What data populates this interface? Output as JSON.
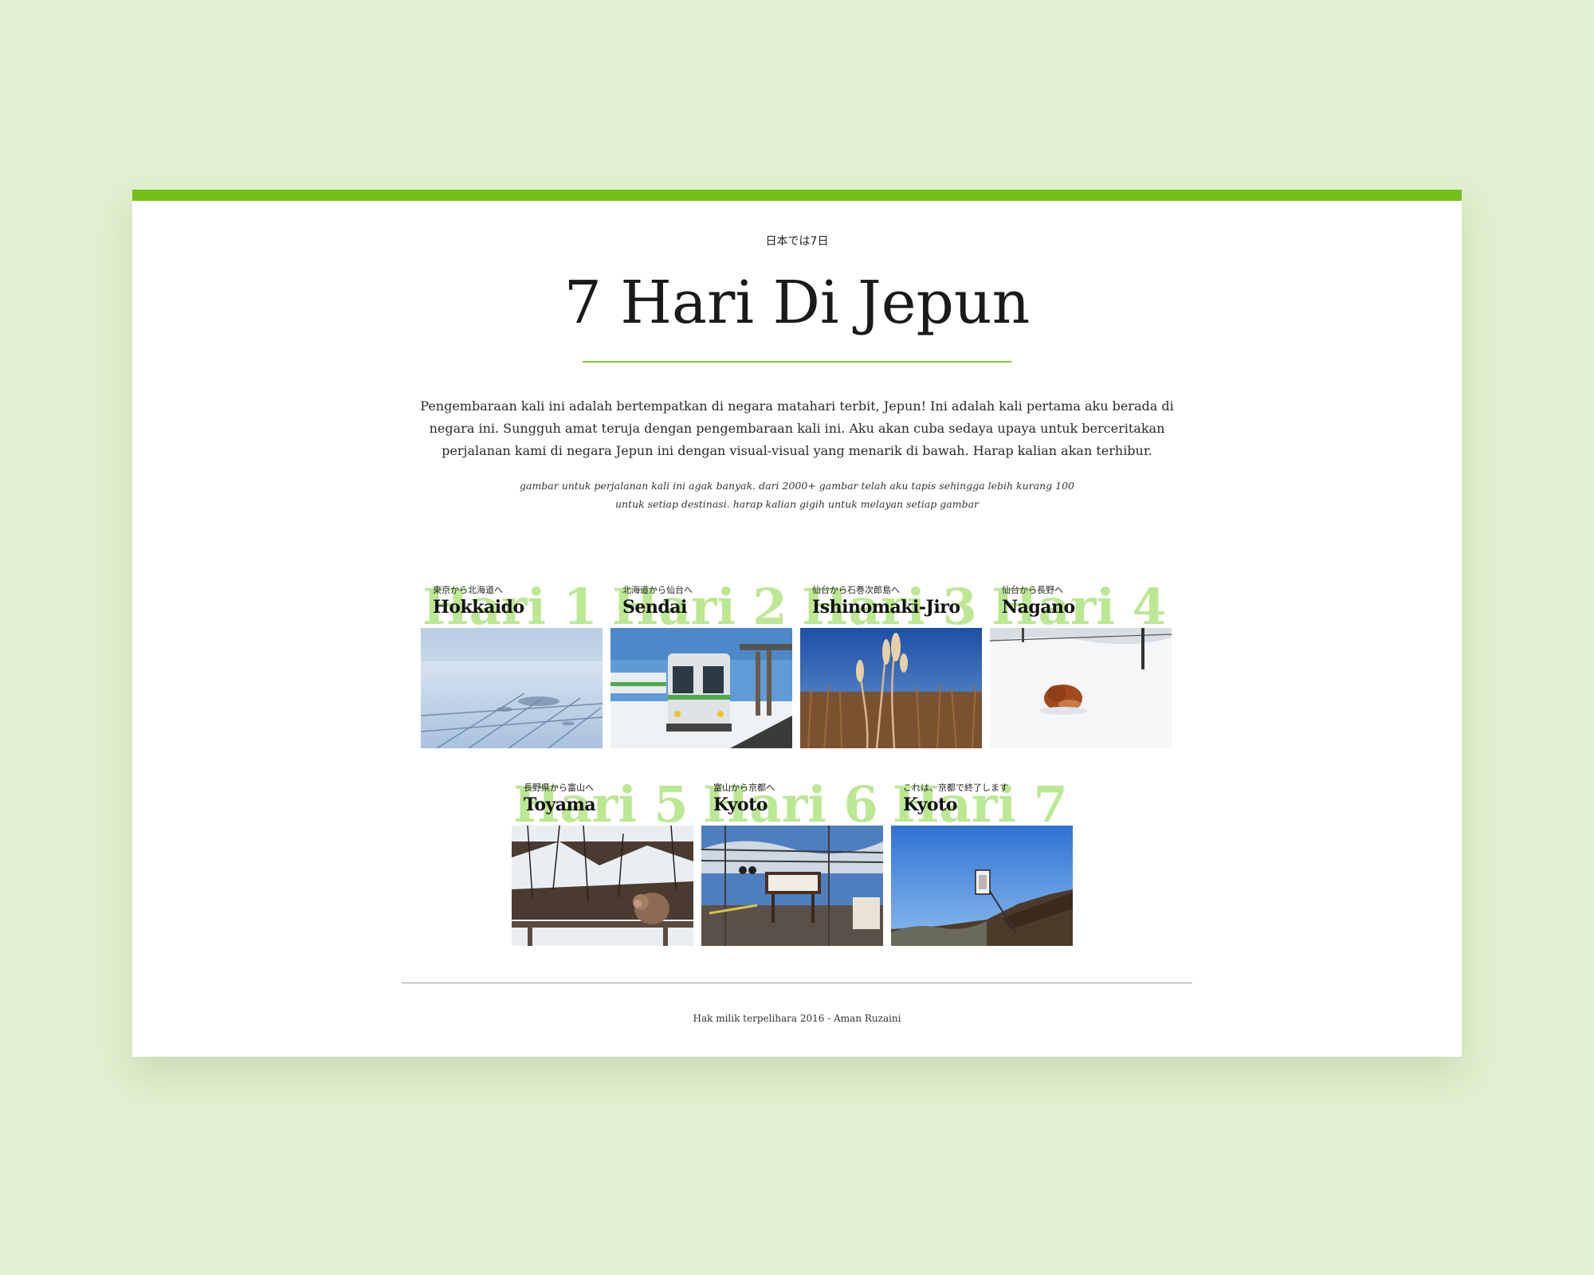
{
  "header": {
    "subtitle": "日本では7日",
    "title": "7 Hari Di Jepun"
  },
  "intro": "Pengembaraan kali ini adalah bertempatkan di negara matahari terbit, Jepun! Ini adalah kali pertama aku berada di negara ini. Sungguh amat teruja dengan pengembaraan kali ini. Aku akan cuba sedaya upaya untuk berceritakan perjalanan kami di negara Jepun ini dengan visual-visual yang menarik di bawah. Harap kalian akan terhibur.",
  "note": "gambar untuk perjalanan kali ini agak banyak. dari 2000+ gambar telah aku tapis sehingga lebih kurang 100 untuk setiap destinasi. harap kalian gigih untuk melayan setiap gambar",
  "days": [
    {
      "label": "Hari 1",
      "from": "東京から北海道へ",
      "city": "Hokkaido",
      "photo": "snowy-aerial-plain"
    },
    {
      "label": "Hari 2",
      "from": "北海道から仙台へ",
      "city": "Sendai",
      "photo": "train-in-snow"
    },
    {
      "label": "Hari 3",
      "from": "仙台から石巻次郎島へ",
      "city": "Ishinomaki-Jiro",
      "photo": "dry-grass-blue-sky"
    },
    {
      "label": "Hari 4",
      "from": "仙台から長野へ",
      "city": "Nagano",
      "photo": "fox-in-snow"
    },
    {
      "label": "Hari 5",
      "from": "長野県から富山へ",
      "city": "Toyama",
      "photo": "snow-monkeys"
    },
    {
      "label": "Hari 6",
      "from": "富山から京都へ",
      "city": "Kyoto",
      "photo": "railway-crossing"
    },
    {
      "label": "Hari 7",
      "from": "これは、京都で終了します",
      "city": "Kyoto",
      "photo": "lantern-blue-sky"
    }
  ],
  "footer": "Hak milik terpelihara 2016 - Aman Ruzaini",
  "colors": {
    "accent": "#74bf1c",
    "day_label": "#b7e58a",
    "page_background": "#e2efd0"
  }
}
